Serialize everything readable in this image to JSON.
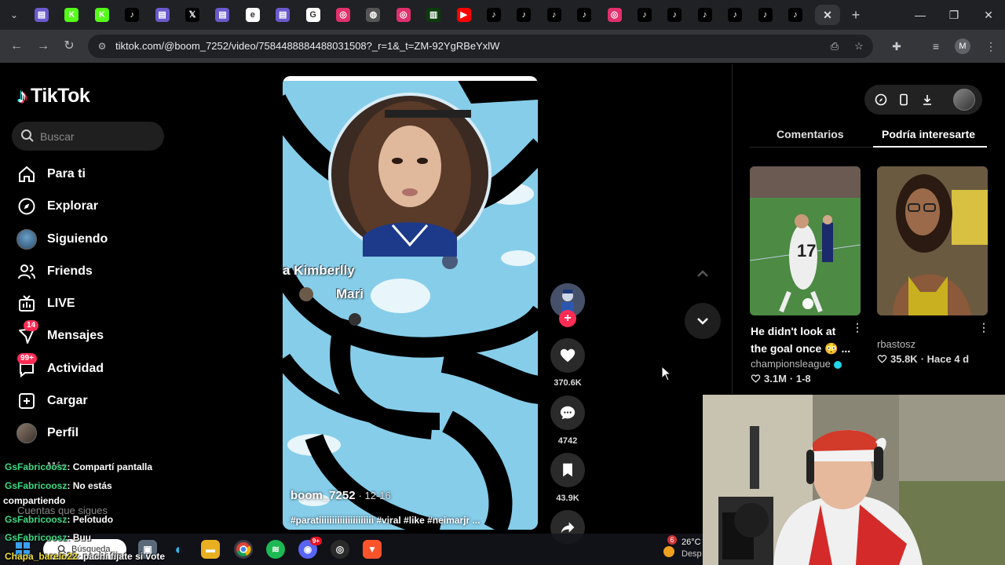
{
  "browser": {
    "url": "tiktok.com/@boom_7252/video/7584488884488031508?_r=1&_t=ZM-92YgRBeYxlW",
    "profile_initial": "M",
    "tabs": [
      {
        "icon": "doc-icon",
        "color": "#6a5acd",
        "glyph": "▤"
      },
      {
        "icon": "kick-icon",
        "color": "#53fc18",
        "glyph": "K"
      },
      {
        "icon": "kick-icon",
        "color": "#53fc18",
        "glyph": "K"
      },
      {
        "icon": "tiktok-icon",
        "color": "#000000",
        "glyph": "♪"
      },
      {
        "icon": "doc-icon",
        "color": "#6a5acd",
        "glyph": "▤"
      },
      {
        "icon": "x-icon",
        "color": "#000000",
        "glyph": "𝕏"
      },
      {
        "icon": "doc-icon",
        "color": "#6a5acd",
        "glyph": "▤"
      },
      {
        "icon": "e-icon",
        "color": "#ffffff",
        "glyph": "e"
      },
      {
        "icon": "doc-icon",
        "color": "#6a5acd",
        "glyph": "▤"
      },
      {
        "icon": "google-icon",
        "color": "#ffffff",
        "glyph": "G"
      },
      {
        "icon": "instagram-icon",
        "color": "#e1306c",
        "glyph": "◎"
      },
      {
        "icon": "globe-icon",
        "color": "#555555",
        "glyph": "◍"
      },
      {
        "icon": "instagram-icon",
        "color": "#e1306c",
        "glyph": "◎"
      },
      {
        "icon": "chart-icon",
        "color": "#0b3d0b",
        "glyph": "▥"
      },
      {
        "icon": "youtube-icon",
        "color": "#ff0000",
        "glyph": "▶"
      },
      {
        "icon": "tiktok-icon",
        "color": "#000000",
        "glyph": "♪"
      },
      {
        "icon": "tiktok-icon",
        "color": "#000000",
        "glyph": "♪"
      },
      {
        "icon": "tiktok-icon",
        "color": "#000000",
        "glyph": "♪"
      },
      {
        "icon": "tiktok-icon",
        "color": "#000000",
        "glyph": "♪"
      },
      {
        "icon": "instagram-icon",
        "color": "#e1306c",
        "glyph": "◎"
      },
      {
        "icon": "tiktok-icon",
        "color": "#000000",
        "glyph": "♪"
      },
      {
        "icon": "tiktok-icon",
        "color": "#000000",
        "glyph": "♪"
      },
      {
        "icon": "tiktok-icon",
        "color": "#000000",
        "glyph": "♪"
      },
      {
        "icon": "tiktok-icon",
        "color": "#000000",
        "glyph": "♪"
      },
      {
        "icon": "tiktok-icon",
        "color": "#000000",
        "glyph": "♪"
      },
      {
        "icon": "tiktok-icon",
        "color": "#000000",
        "glyph": "♪"
      }
    ],
    "active_tab_glyph": "✕"
  },
  "tiktok": {
    "logo_text": "TikTok",
    "search_placeholder": "Buscar",
    "nav": [
      {
        "name": "home",
        "label": "Para ti"
      },
      {
        "name": "explore",
        "label": "Explorar"
      },
      {
        "name": "following",
        "label": "Siguiendo"
      },
      {
        "name": "friends",
        "label": "Friends"
      },
      {
        "name": "live",
        "label": "LIVE"
      },
      {
        "name": "messages",
        "label": "Mensajes",
        "badge": "14"
      },
      {
        "name": "activity",
        "label": "Actividad",
        "badge": "99+"
      },
      {
        "name": "upload",
        "label": "Cargar"
      },
      {
        "name": "profile",
        "label": "Perfil"
      }
    ],
    "ghost_labels": [
      "Más",
      "Cuentas que sigues"
    ],
    "video": {
      "overlay_line1": "a Kimberlly",
      "overlay_line2": "Mari",
      "username": "boom_7252",
      "date": "· 12-16",
      "caption": "#paratiiiiiiiiiiiiiiiiiiiii #viral #like #neimarjr ..."
    },
    "actions": {
      "likes": "370.6K",
      "comments": "4742",
      "saves": "43.9K"
    },
    "right_panel": {
      "tab_comments": "Comentarios",
      "tab_suggested": "Podría interesarte",
      "cards": [
        {
          "title": "He didn't look at the goal once 😳 ...",
          "author": "championsleague",
          "likes": "3.1M",
          "extra": "· 1-8"
        },
        {
          "title": "",
          "author": "rbastosz",
          "likes": "35.8K",
          "extra": "· Hace 4 d"
        }
      ]
    }
  },
  "chat": [
    {
      "user": "GsFabricoosz",
      "message": ": Compartí pantalla"
    },
    {
      "user": "GsFabricoosz",
      "message": ": No estás"
    },
    {
      "user": "",
      "message": "compartiendo"
    },
    {
      "user": "GsFabricoosz",
      "message": ": Pelotudo"
    },
    {
      "user": "GsFabricoosz",
      "message": ": Buu"
    },
    {
      "user": "Chapa_barelo22",
      "message": ": pachi fijate si vote"
    }
  ],
  "taskbar": {
    "search_label": "Búsqueda",
    "discord_badge": "9+",
    "weather_temp": "26°C",
    "weather_desc": "Desp",
    "weather_badge": "6"
  }
}
